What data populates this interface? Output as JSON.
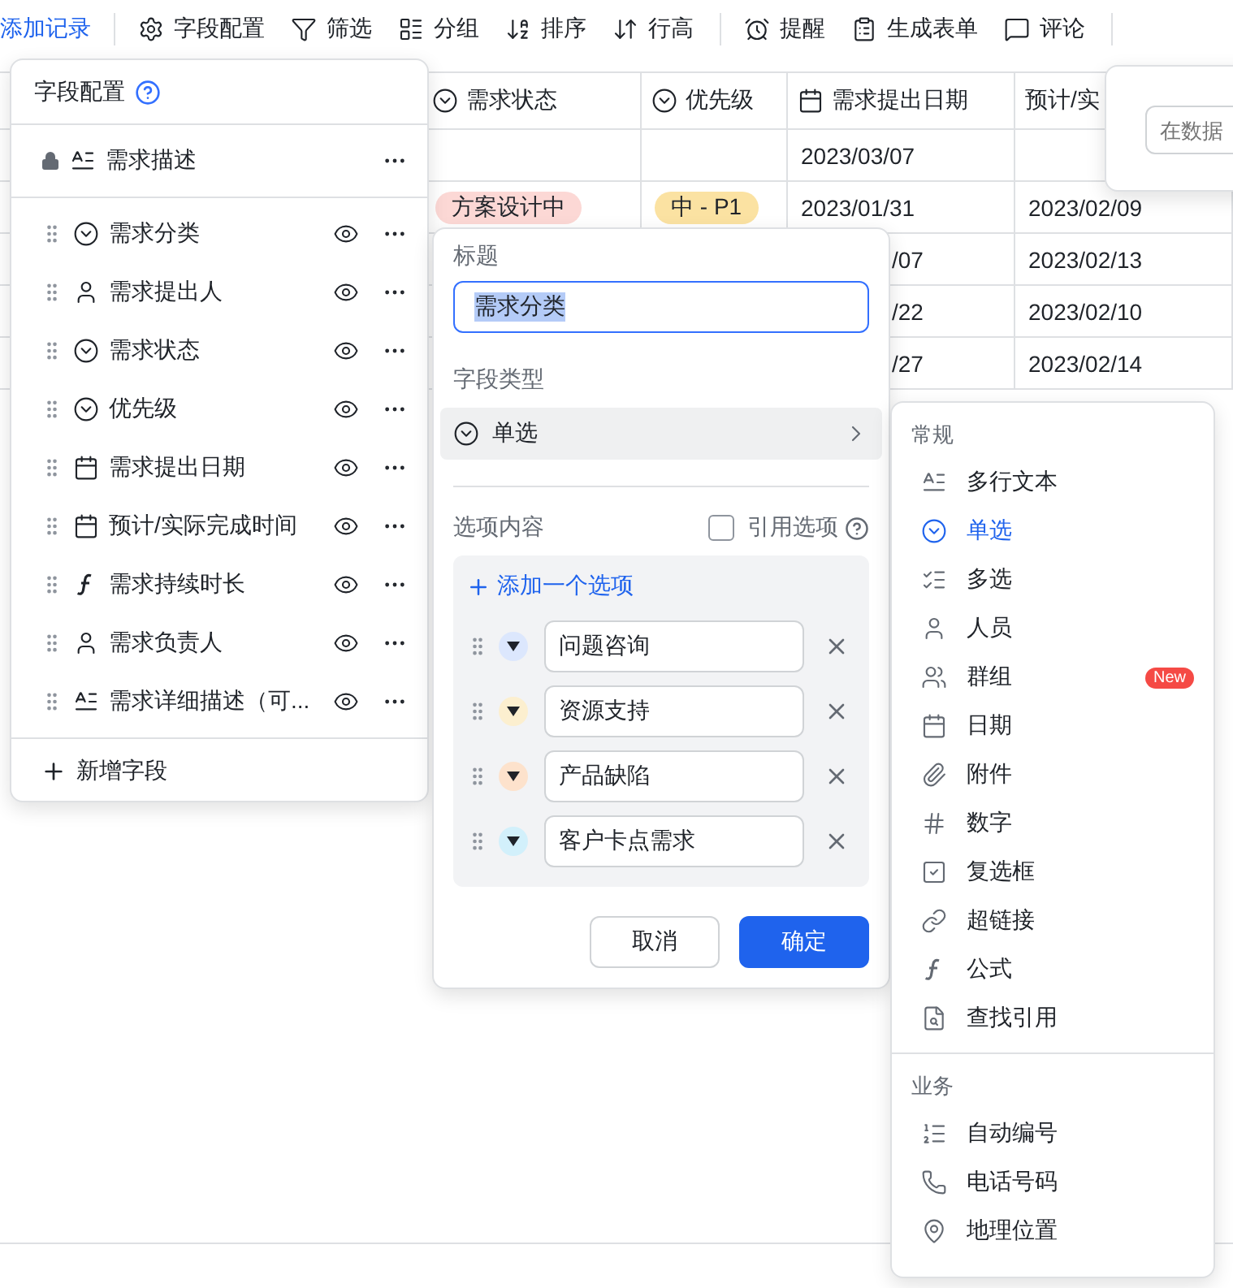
{
  "toolbar": {
    "add_record": "添加记录",
    "items": [
      {
        "label": "字段配置"
      },
      {
        "label": "筛选"
      },
      {
        "label": "分组"
      },
      {
        "label": "排序"
      },
      {
        "label": "行高"
      }
    ],
    "items_2": [
      {
        "label": "提醒"
      },
      {
        "label": "生成表单"
      },
      {
        "label": "评论"
      }
    ]
  },
  "table": {
    "columns": [
      {
        "label": "需求状态",
        "kind": "single"
      },
      {
        "label": "优先级",
        "kind": "single"
      },
      {
        "label": "需求提出日期",
        "kind": "date"
      },
      {
        "label": "预计/实",
        "kind": "plain"
      }
    ],
    "rows": [
      {
        "proposed_date": "2023/03/07"
      },
      {
        "status_tag": {
          "text": "方案设计中",
          "color": "#fcd8d5"
        },
        "priority_tag": {
          "text": "中 - P1",
          "color": "#fbe2a2"
        },
        "proposed_date": "2023/01/31",
        "planned_date": "2023/02/09"
      },
      {
        "proposed_date_tail": "/07",
        "planned_date": "2023/02/13"
      },
      {
        "proposed_date_tail": "/22",
        "planned_date": "2023/02/10"
      },
      {
        "proposed_date_tail": "/27",
        "planned_date": "2023/02/14"
      }
    ]
  },
  "search_popover": {
    "placeholder": "在数据"
  },
  "field_panel": {
    "title": "字段配置",
    "locked_field": {
      "name": "需求描述",
      "kind": "text"
    },
    "fields": [
      {
        "name": "需求分类",
        "kind": "single"
      },
      {
        "name": "需求提出人",
        "kind": "person"
      },
      {
        "name": "需求状态",
        "kind": "single"
      },
      {
        "name": "优先级",
        "kind": "single"
      },
      {
        "name": "需求提出日期",
        "kind": "date"
      },
      {
        "name": "预计/实际完成时间",
        "kind": "date"
      },
      {
        "name": "需求持续时长",
        "kind": "formula"
      },
      {
        "name": "需求负责人",
        "kind": "person"
      },
      {
        "name": "需求详细描述（可...",
        "kind": "text"
      }
    ],
    "add_field": "新增字段"
  },
  "field_editor": {
    "title_label": "标题",
    "title_value": "需求分类",
    "title_value_selected": true,
    "type_label": "字段类型",
    "type_value": "单选",
    "options_label": "选项内容",
    "reference_options": {
      "label": "引用选项",
      "checked": false
    },
    "add_option": "添加一个选项",
    "options": [
      {
        "text": "问题咨询",
        "color": "#dce7fd"
      },
      {
        "text": "资源支持",
        "color": "#fcefcf"
      },
      {
        "text": "产品缺陷",
        "color": "#fde2cc"
      },
      {
        "text": "客户卡点需求",
        "color": "#d2f0fb"
      }
    ],
    "cancel": "取消",
    "confirm": "确定"
  },
  "type_menu": {
    "sections": [
      {
        "title": "常规",
        "items": [
          {
            "label": "多行文本",
            "selected": false
          },
          {
            "label": "单选",
            "selected": true
          },
          {
            "label": "多选",
            "selected": false
          },
          {
            "label": "人员",
            "selected": false
          },
          {
            "label": "群组",
            "selected": false,
            "badge": "New"
          },
          {
            "label": "日期",
            "selected": false
          },
          {
            "label": "附件",
            "selected": false
          },
          {
            "label": "数字",
            "selected": false
          },
          {
            "label": "复选框",
            "selected": false
          },
          {
            "label": "超链接",
            "selected": false
          },
          {
            "label": "公式",
            "selected": false
          },
          {
            "label": "查找引用",
            "selected": false
          }
        ]
      },
      {
        "title": "业务",
        "items": [
          {
            "label": "自动编号",
            "selected": false
          },
          {
            "label": "电话号码",
            "selected": false
          },
          {
            "label": "地理位置",
            "selected": false
          }
        ]
      }
    ]
  }
}
